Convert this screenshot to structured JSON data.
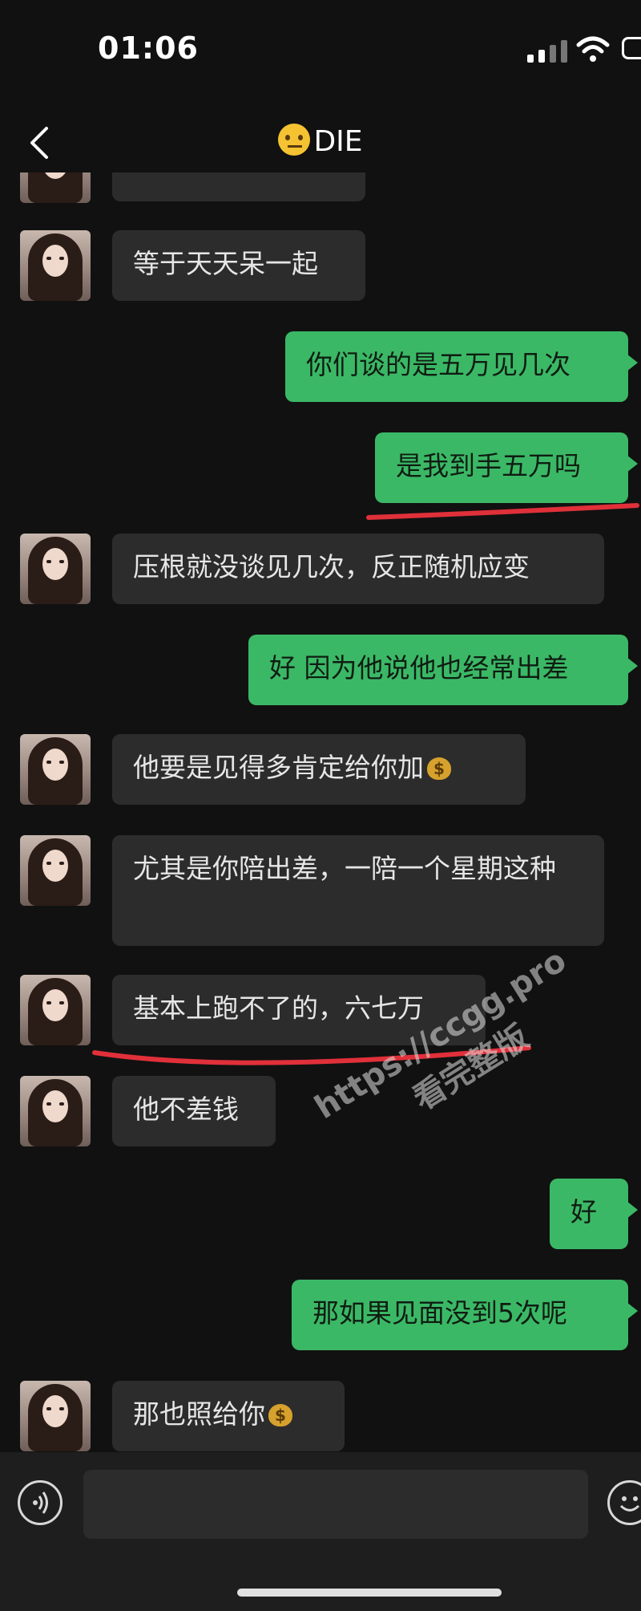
{
  "status": {
    "time": "01:06"
  },
  "header": {
    "title": "DIE",
    "title_emoji": "face-with-raised-eyebrow"
  },
  "messages": [
    {
      "from": "them",
      "text": "等于天天呆一起"
    },
    {
      "from": "me",
      "text": "你们谈的是五万见几次"
    },
    {
      "from": "me",
      "text": "是我到手五万吗"
    },
    {
      "from": "them",
      "text": "压根就没谈见几次，反正随机应变"
    },
    {
      "from": "me",
      "text": "好 因为他说他也经常出差"
    },
    {
      "from": "them",
      "text": "他要是见得多肯定给你加",
      "icon": "money-bag"
    },
    {
      "from": "them",
      "text": "尤其是你陪出差，一陪一个星期这种"
    },
    {
      "from": "them",
      "text": "基本上跑不了的，六七万"
    },
    {
      "from": "them",
      "text": "他不差钱"
    },
    {
      "from": "me",
      "text": "好"
    },
    {
      "from": "me",
      "text": "那如果见面没到5次呢"
    },
    {
      "from": "them",
      "text": "那也照给你",
      "icon": "money-bag"
    }
  ],
  "watermark": {
    "url": "https://ccgg.pro",
    "text": "看完整版"
  },
  "colors": {
    "background": "#111111",
    "incoming_bubble": "#2c2c2c",
    "outgoing_bubble": "#3bb866",
    "highlight_line": "#e0303a"
  }
}
